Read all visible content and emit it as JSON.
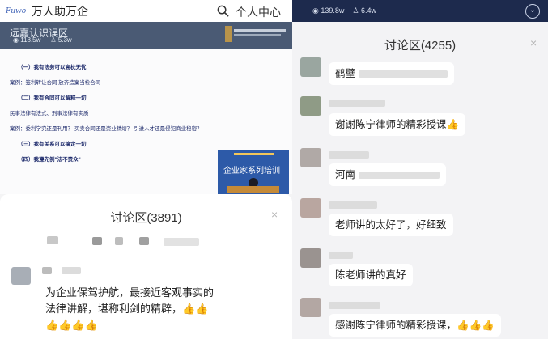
{
  "left": {
    "app_title": "万人助万企",
    "profile_label": "个人中心",
    "video": {
      "title": "远嘉认识误区",
      "views": "118.5w",
      "likes": "5.3w",
      "slide_lines": [
        "（一）我有法务可以高枕无忧",
        "案例：签利转让合同        放齐造案当检合同",
        "（二）我有合同可以解释一切",
        "民事法律有法式、刑事法律有实质",
        "案例：委利学究还是刊用？    买卖合同还是资业精熔？    引进人才还是侵犯商业秘密？",
        "（三）我有关系可以搞定一切",
        "（四）我遵先例\"法不责众\""
      ],
      "inset_title": "企业家系列培训"
    },
    "comments": {
      "title": "讨论区(3891)",
      "close": "×",
      "comment_line1": "为企业保驾护航，最接近客观事实的",
      "comment_line2": "法律讲解，堪称利剑的精辟，👍👍",
      "comment_line3": "👍👍👍👍"
    }
  },
  "right": {
    "header": {
      "views": "139.8w",
      "likes": "6.4w",
      "chevron": "⌄"
    },
    "title": "讨论区(4255)",
    "close": "×",
    "comments": [
      {
        "text": "鹤壁"
      },
      {
        "text": "谢谢陈宁律师的精彩授课👍"
      },
      {
        "text": "河南"
      },
      {
        "text": "老师讲的太好了，好细致"
      },
      {
        "text": "陈老师讲的真好"
      },
      {
        "text": "感谢陈宁律师的精彩授课，👍👍👍"
      }
    ]
  },
  "colors": {
    "header_dark": "#1d2a4d",
    "video_header": "#4a5a74",
    "inset_blue": "#2d5aa8"
  }
}
